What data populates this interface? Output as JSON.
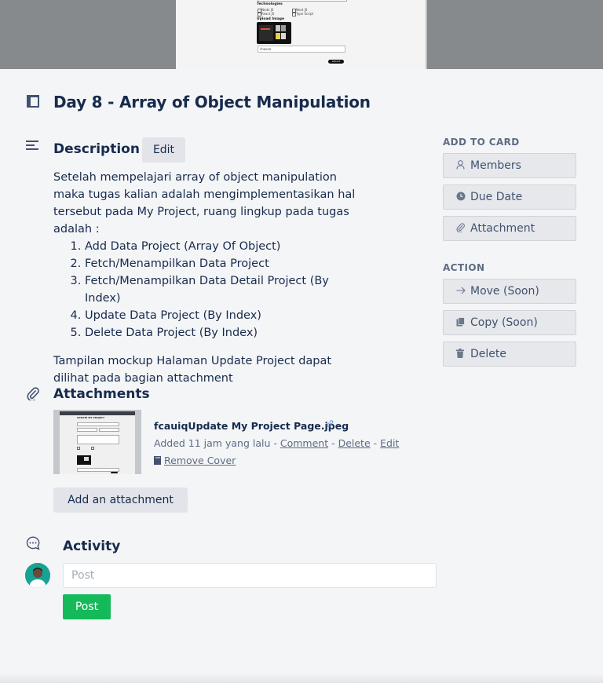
{
  "cover": {
    "technologies_label": "Technologies",
    "tech_options": [
      "Node JS",
      "Next JS",
      "React JS",
      "Type Script"
    ],
    "upload_label": "Upload Image",
    "file_label": "choose",
    "submit_label": "submit"
  },
  "card": {
    "title": "Day 8 - Array of Object Manipulation"
  },
  "description": {
    "heading": "Description",
    "edit_label": "Edit",
    "intro": "Setelah mempelajari array of object manipulation maka tugas kalian adalah mengimplementasikan hal tersebut pada My Project, ruang lingkup pada tugas adalah :",
    "items": [
      "Add Data Project (Array Of Object)",
      "Fetch/Menampilkan Data Project",
      "Fetch/Menampilkan Data Detail Project (By Index)",
      "Update Data Project (By Index)",
      "Delete Data Project (By Index)"
    ],
    "outro": "Tampilan mockup Halaman Update Project dapat dilihat pada bagian attachment"
  },
  "attachments": {
    "heading": "Attachments",
    "thumb_title": "UPDATE MY PROJECT",
    "file_name": "fcauiqUpdate My Project Page.jpeg",
    "added_text": "Added 11 jam yang lalu",
    "sep": " - ",
    "comment_label": "Comment",
    "delete_label": "Delete",
    "edit_label": "Edit",
    "remove_cover_label": "Remove Cover",
    "add_label": "Add an attachment"
  },
  "activity": {
    "heading": "Activity",
    "input_placeholder": "Post",
    "post_label": "Post"
  },
  "sidebar": {
    "add_to_card_heading": "ADD TO CARD",
    "add_items": [
      {
        "label": "Members",
        "icon": "person-icon"
      },
      {
        "label": "Due Date",
        "icon": "clock-icon"
      },
      {
        "label": "Attachment",
        "icon": "paperclip-icon"
      }
    ],
    "action_heading": "ACTION",
    "action_items": [
      {
        "label": "Move (Soon)",
        "icon": "arrow-right-icon"
      },
      {
        "label": "Copy (Soon)",
        "icon": "copy-icon"
      },
      {
        "label": "Delete",
        "icon": "trash-icon"
      }
    ]
  },
  "colors": {
    "background": "#f4f5f7",
    "text": "#172b4d",
    "muted": "#5e6c84",
    "button_gray": "#e2e4e9",
    "post_green": "#14ba5a",
    "cover_gray": "#868a8d"
  }
}
